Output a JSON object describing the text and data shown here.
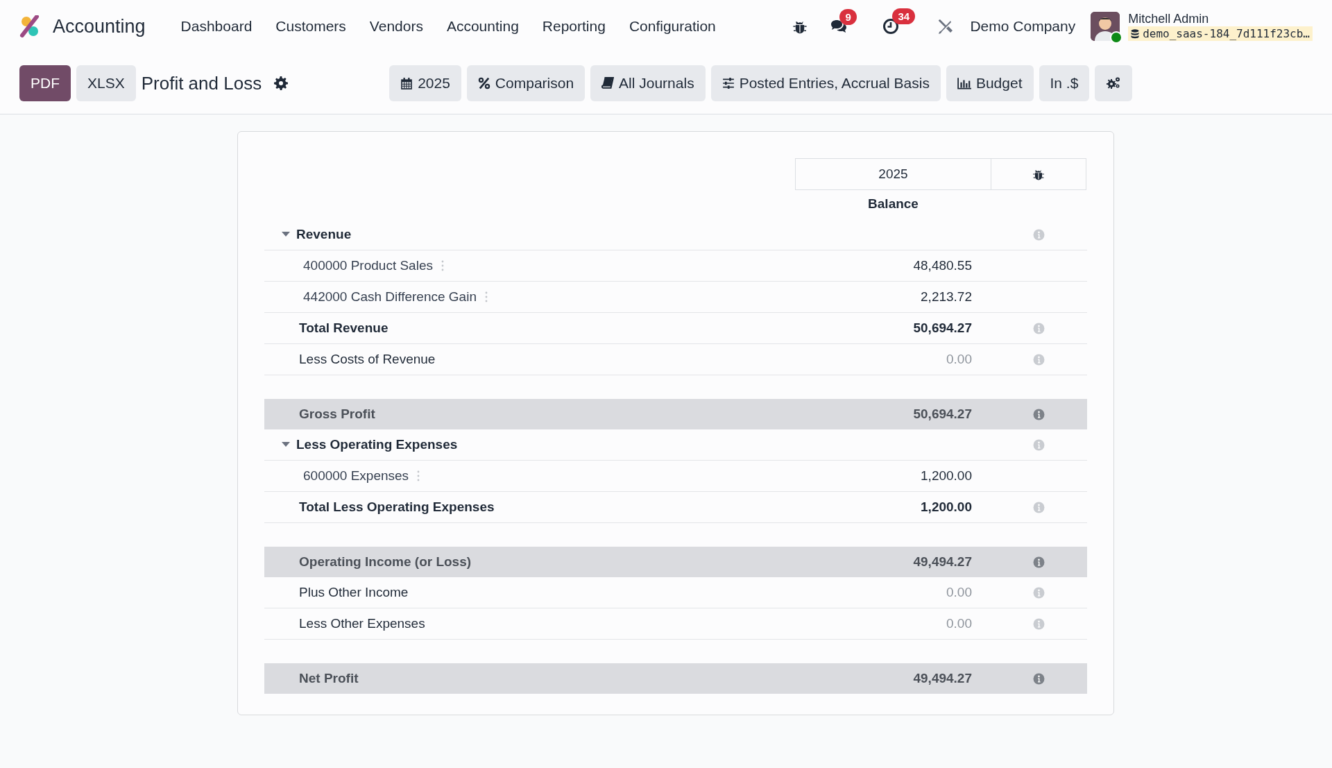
{
  "navbar": {
    "app_name": "Accounting",
    "menu": [
      "Dashboard",
      "Customers",
      "Vendors",
      "Accounting",
      "Reporting",
      "Configuration"
    ],
    "badges": [
      {
        "count": "9"
      },
      {
        "count": "34"
      }
    ],
    "company": "Demo Company",
    "user": {
      "name": "Mitchell Admin",
      "database": "demo_saas-184_7d111f23cb…",
      "online": true
    }
  },
  "control_panel": {
    "export_buttons": [
      {
        "label": "PDF",
        "primary": true
      },
      {
        "label": "XLSX",
        "primary": false
      }
    ],
    "title": "Profit and Loss",
    "filters": [
      {
        "label": "2025"
      },
      {
        "label": "Comparison"
      },
      {
        "label": "All Journals"
      },
      {
        "label": "Posted Entries, Accrual Basis"
      },
      {
        "label": "Budget"
      },
      {
        "label": "In .$"
      }
    ]
  },
  "report": {
    "column_header": "2025",
    "column_subheader": "Balance",
    "rows": [
      {
        "kind": "section",
        "label": "Revenue",
        "expanded": true
      },
      {
        "kind": "line",
        "label": "400000 Product Sales",
        "value": "48,480.55",
        "dimmed": false
      },
      {
        "kind": "line",
        "label": "442000 Cash Difference Gain",
        "value": "2,213.72",
        "dimmed": false
      },
      {
        "kind": "total",
        "label": "Total Revenue",
        "value": "50,694.27",
        "dimmed": false
      },
      {
        "kind": "plain",
        "label": "Less Costs of Revenue",
        "value": "0.00",
        "dimmed": true
      },
      {
        "kind": "highlight",
        "label": "Gross Profit",
        "value": "50,694.27",
        "dimmed": false
      },
      {
        "kind": "section",
        "label": "Less Operating Expenses",
        "expanded": true
      },
      {
        "kind": "line",
        "label": "600000 Expenses",
        "value": "1,200.00",
        "dimmed": false
      },
      {
        "kind": "total",
        "label": "Total Less Operating Expenses",
        "value": "1,200.00",
        "dimmed": false
      },
      {
        "kind": "highlight",
        "label": "Operating Income (or Loss)",
        "value": "49,494.27",
        "dimmed": false
      },
      {
        "kind": "plain",
        "label": "Plus Other Income",
        "value": "0.00",
        "dimmed": true
      },
      {
        "kind": "plain",
        "label": "Less Other Expenses",
        "value": "0.00",
        "dimmed": true
      },
      {
        "kind": "highlight",
        "label": "Net Profit",
        "value": "49,494.27",
        "dimmed": false
      }
    ]
  }
}
